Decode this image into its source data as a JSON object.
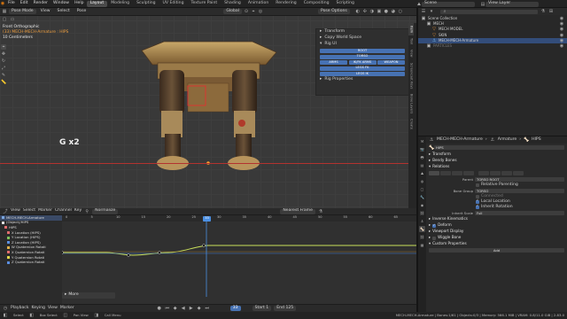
{
  "topbar": {
    "menus": [
      "File",
      "Edit",
      "Render",
      "Window",
      "Help"
    ],
    "workspaces": [
      "Layout",
      "Modeling",
      "Sculpting",
      "UV Editing",
      "Texture Paint",
      "Shading",
      "Animation",
      "Rendering",
      "Compositing",
      "Scripting"
    ],
    "active_workspace": "Layout",
    "scene": "Scene",
    "view_layer": "View Layer"
  },
  "viewport": {
    "mode": "Pose Mode",
    "menus": [
      "View",
      "Select",
      "Pose"
    ],
    "transform_space": "Global",
    "pose_options": "Pose Options",
    "info_lines": [
      "Front Orthographic",
      "(33) MECH-MECH-Armature : HIPS",
      "10 Centimeters"
    ],
    "overlay_text": "G x2",
    "sidebar": {
      "transform": "Transform",
      "copy_world_space": "Copy World Space",
      "rig_ui": "Rig UI",
      "root": "ROOT",
      "torso": "TORSO",
      "arms": "ARMS",
      "ik_fk": "IK/FK ARMS",
      "weapon": "WEAPON",
      "legs_fk": "LEGS FK",
      "legs_ik": "LEGS IK",
      "rig_properties": "Rig Properties"
    },
    "tabs": [
      "Item",
      "Tool",
      "View",
      "Screencast Keys",
      "Bone Layers",
      "Create"
    ]
  },
  "outliner": {
    "search_placeholder": "",
    "items": [
      {
        "label": "Scene Collection",
        "indent": 0,
        "icon": "collection-icon"
      },
      {
        "label": "MECH",
        "indent": 1,
        "icon": "collection-icon"
      },
      {
        "label": "MECH MODEL",
        "indent": 2,
        "icon": "object-icon"
      },
      {
        "label": "SKIN",
        "indent": 2,
        "icon": "object-icon"
      },
      {
        "label": "MECH-MECH-Armature",
        "indent": 2,
        "icon": "armature-icon",
        "selected": true
      },
      {
        "label": "PARTICLES",
        "indent": 1,
        "icon": "collection-icon",
        "dim": true
      }
    ]
  },
  "properties": {
    "breadcrumb": [
      "MECH-MECH-Armature",
      "Armature",
      "HIPS"
    ],
    "bone_name": "HIPS",
    "sections": {
      "transform": "Transform",
      "bendy_bones": "Bendy Bones",
      "relations": "Relations",
      "inverse_kinematics": "Inverse Kinematics",
      "deform": "Deform",
      "viewport_display": "Viewport Display",
      "wiggle_bone": "Wiggle Bone",
      "custom_properties": "Custom Properties"
    },
    "parent_label": "Parent",
    "parent_value": "TORSO ROOT",
    "relative_parenting": "Relative Parenting",
    "bone_group_label": "Bone Group",
    "bone_group_value": "TORSO",
    "connected": "Connected",
    "local_location": "Local Location",
    "inherit_rotation": "Inherit Rotation",
    "inherit_scale_label": "Inherit Scale",
    "inherit_scale_value": "Full",
    "add_button": "Add"
  },
  "graph_editor": {
    "menus": [
      "View",
      "Select",
      "Marker",
      "Channel",
      "Key"
    ],
    "mode": "Normalize",
    "pivot": "Nearest Frame",
    "channels": [
      {
        "label": "MECH-MECH-Armature",
        "level": 0,
        "color": "#7aa6e0"
      },
      {
        "label": "(Object)/HIPS",
        "level": 0,
        "color": "#dddddd"
      },
      {
        "label": "HIPS",
        "level": 1,
        "color": "#e06c6c"
      },
      {
        "label": "X Location (HIPS)",
        "level": 2,
        "color": "#e06c6c"
      },
      {
        "label": "Y Location (HIPS)",
        "level": 2,
        "color": "#7ec25a"
      },
      {
        "label": "Z Location (HIPS)",
        "level": 2,
        "color": "#5a8ee0"
      },
      {
        "label": "W Quaternion Rotati",
        "level": 2,
        "color": "#e0b04a"
      },
      {
        "label": "X Quaternion Rotati",
        "level": 2,
        "color": "#e06c6c"
      },
      {
        "label": "Y Quaternion Rotati",
        "level": 2,
        "color": "#e0d84a"
      },
      {
        "label": "Z Quaternion Rotati",
        "level": 2,
        "color": "#5a8ee0"
      }
    ],
    "ruler_labels": [
      "0",
      "5",
      "10",
      "15",
      "20",
      "25",
      "30",
      "35",
      "40",
      "45",
      "50",
      "55",
      "60",
      "65"
    ],
    "current_frame": "33",
    "more": "More"
  },
  "timeline": {
    "menus": [
      "Playback",
      "Keying",
      "View",
      "Marker"
    ],
    "start_label": "Start",
    "start": "1",
    "end_label": "End",
    "end": "125"
  },
  "statusbar": {
    "items": [
      "Select",
      "Box Select",
      "Pan View",
      "Call Menu"
    ],
    "info": "MECH-MECH-Armature | Bones:1/61 | Objects:0/3 | Memory: 566.1 MiB | VRAM: 0.8/11.0 GiB | 2.83.0"
  }
}
